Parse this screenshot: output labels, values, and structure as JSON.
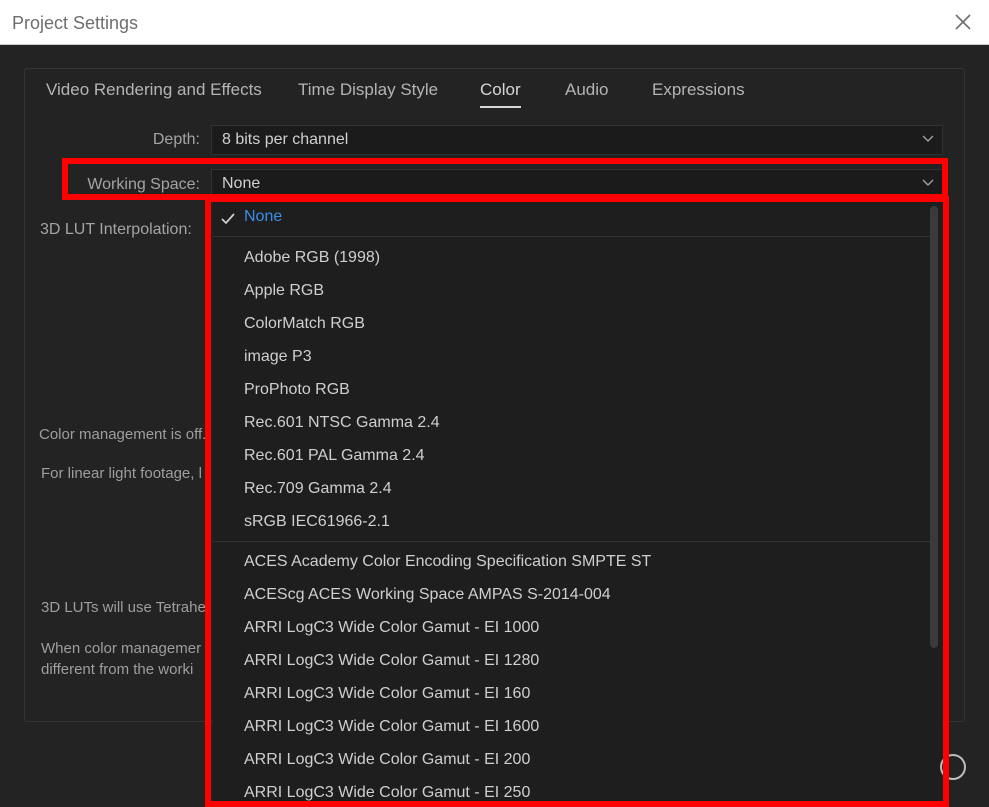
{
  "window": {
    "title": "Project Settings"
  },
  "tabs": [
    {
      "label": "Video Rendering and Effects"
    },
    {
      "label": "Time Display Style"
    },
    {
      "label": "Color"
    },
    {
      "label": "Audio"
    },
    {
      "label": "Expressions"
    }
  ],
  "active_tab": "Color",
  "settings": {
    "depth": {
      "label": "Depth:",
      "value": "8 bits per channel"
    },
    "working_space": {
      "label": "Working Space:",
      "value": "None"
    },
    "lut_interpolation": {
      "label": "3D LUT Interpolation:"
    }
  },
  "background_text": {
    "color_mgmt_off": "Color management is off.",
    "linear_light": "For linear light footage, l",
    "luts_tetra": "3D LUTs will use Tetrahe",
    "when_color_1": "When color managemer",
    "when_color_2": "different from the worki"
  },
  "dropdown": {
    "group1": [
      {
        "label": "None",
        "selected": true
      }
    ],
    "group2": [
      {
        "label": "Adobe RGB (1998)"
      },
      {
        "label": "Apple RGB"
      },
      {
        "label": "ColorMatch RGB"
      },
      {
        "label": "image P3"
      },
      {
        "label": "ProPhoto RGB"
      },
      {
        "label": "Rec.601 NTSC Gamma 2.4"
      },
      {
        "label": "Rec.601 PAL Gamma 2.4"
      },
      {
        "label": "Rec.709 Gamma 2.4"
      },
      {
        "label": "sRGB IEC61966-2.1"
      }
    ],
    "group3": [
      {
        "label": "ACES Academy Color Encoding Specification SMPTE ST"
      },
      {
        "label": "ACEScg ACES Working Space AMPAS S-2014-004"
      },
      {
        "label": "ARRI LogC3 Wide Color Gamut - EI 1000"
      },
      {
        "label": "ARRI LogC3 Wide Color Gamut - EI 1280"
      },
      {
        "label": "ARRI LogC3 Wide Color Gamut - EI 160"
      },
      {
        "label": "ARRI LogC3 Wide Color Gamut - EI 1600"
      },
      {
        "label": "ARRI LogC3 Wide Color Gamut - EI 200"
      },
      {
        "label": "ARRI LogC3 Wide Color Gamut - EI 250"
      }
    ]
  },
  "colors": {
    "background": "#232323",
    "selected_option": "#3b8ee8",
    "annotation_highlight": "#ff0000"
  }
}
